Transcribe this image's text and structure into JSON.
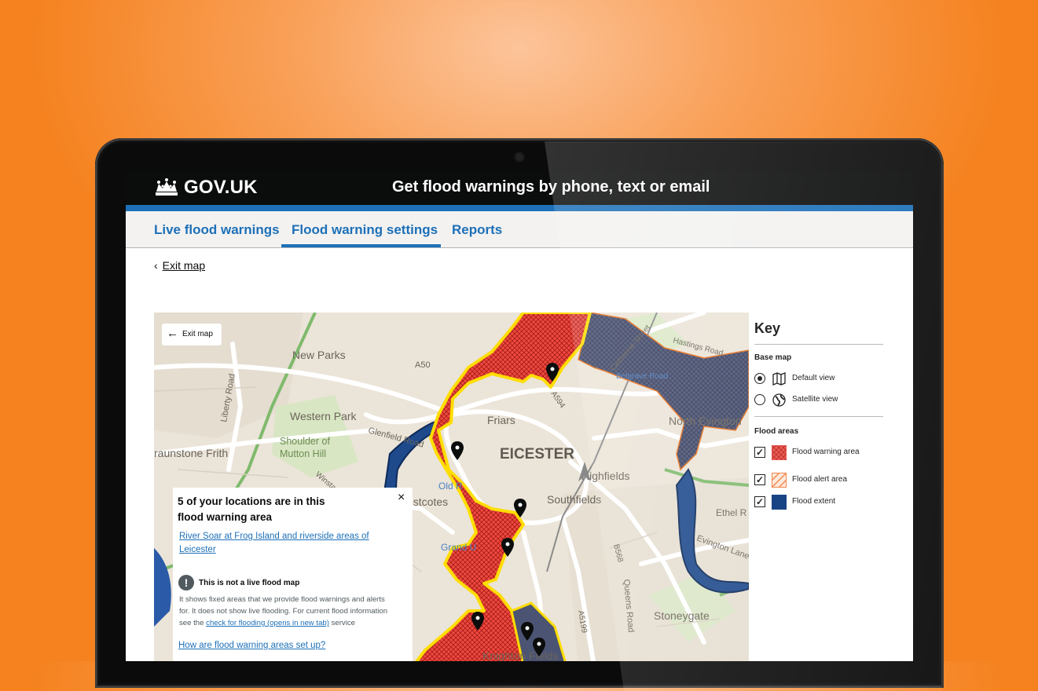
{
  "header": {
    "logo": "GOV.UK",
    "service_name": "Get flood warnings by phone, text or email"
  },
  "nav": {
    "tabs": [
      {
        "label": "Live flood warnings",
        "active": false
      },
      {
        "label": "Flood warning settings",
        "active": true
      },
      {
        "label": "Reports",
        "active": false
      }
    ]
  },
  "back_link": "Exit map",
  "map": {
    "exit_button": "Exit map",
    "place_labels": [
      "New Parks",
      "Western Park",
      "Shoulder of Mutton Hill",
      "raunstone Frith",
      "Friars",
      "EICESTER",
      "Highfields",
      "Southfields",
      "estcotes",
      "Old R",
      "Grand U",
      "North Evington",
      "Ethel R",
      "Evington Lane",
      "Stoneygate",
      "Knighton Fields",
      "Glenfield Road",
      "A50",
      "A594",
      "B568",
      "A5199",
      "Queens Road",
      "Liberty Road",
      "Catherine Street",
      "Hastings Road",
      "Belgrave Road",
      "Winstanley"
    ],
    "popup": {
      "title": "5 of your locations are in this flood warning  area",
      "close_label": "×",
      "area_link": "River Soar at Frog Island and riverside areas of Leicester",
      "warning_title": "This is not a live flood map",
      "warning_text_1": "It shows fixed areas that we provide flood warnings and alerts for. It does not show live flooding. For current flood information see the ",
      "warning_link": "check for flooding (opens in new tab)",
      "warning_text_2": " service",
      "how_link": "How are flood warning areas set up?"
    }
  },
  "key": {
    "title": "Key",
    "base_map_heading": "Base map",
    "base_map_options": [
      {
        "label": "Default view",
        "icon": "map-icon",
        "selected": true
      },
      {
        "label": "Satellite view",
        "icon": "globe-icon",
        "selected": false
      }
    ],
    "flood_areas_heading": "Flood areas",
    "flood_area_options": [
      {
        "label": "Flood warning area",
        "checked": true
      },
      {
        "label": "Flood alert area",
        "checked": true
      },
      {
        "label": "Flood extent",
        "checked": true
      }
    ]
  },
  "colors": {
    "background_orange": "#f5821f",
    "govuk_black": "#0b0c0c",
    "govuk_blue": "#1d70b8",
    "flood_warning_red": "#e8433b",
    "flood_alert_orange": "#f47738",
    "flood_extent_navy": "#003078",
    "warning_area_outline": "#ffdd00"
  }
}
